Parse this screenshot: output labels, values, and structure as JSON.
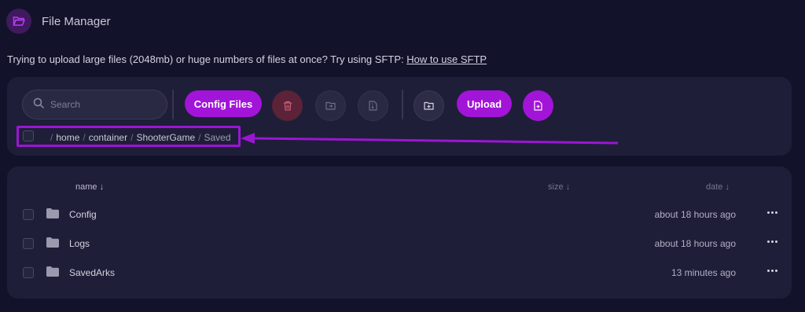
{
  "app": {
    "title": "File Manager",
    "icon": "folder-open-icon"
  },
  "notice": {
    "text": "Trying to upload large files (2048mb) or huge numbers of files at once? Try using SFTP: ",
    "link": "How to use SFTP"
  },
  "toolbar": {
    "search_placeholder": "Search",
    "config_files_label": "Config Files",
    "upload_label": "Upload",
    "icons": [
      "trash-icon",
      "folder-move-icon",
      "file-archive-icon",
      "folder-plus-icon",
      "file-plus-icon"
    ],
    "colors": {
      "accent": "#a214d8",
      "delete_bg": "#5b2238"
    }
  },
  "breadcrumb": {
    "segments": [
      "home",
      "container",
      "ShooterGame",
      "Saved"
    ],
    "separator": "/"
  },
  "table": {
    "columns": {
      "name": "name ↓",
      "size": "size ↓",
      "date": "date ↓"
    },
    "rows": [
      {
        "name": "Config",
        "date": "about 18 hours ago"
      },
      {
        "name": "Logs",
        "date": "about 18 hours ago"
      },
      {
        "name": "SavedArks",
        "date": "13 minutes ago"
      }
    ]
  }
}
